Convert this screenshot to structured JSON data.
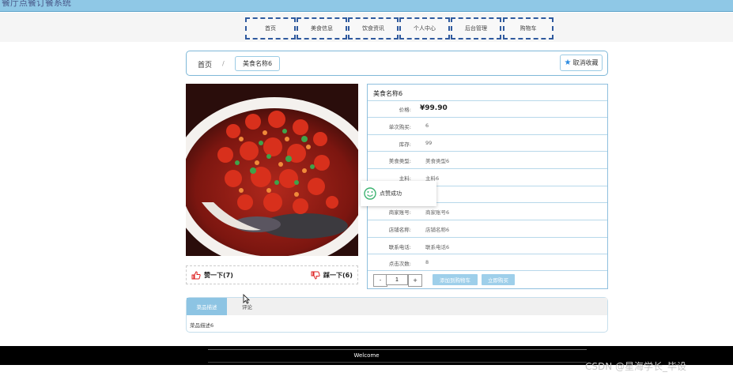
{
  "site": {
    "title": "餐厅点餐订餐系统"
  },
  "nav": {
    "items": [
      "首页",
      "美食信息",
      "饮食资讯",
      "个人中心",
      "后台管理",
      "购物车"
    ]
  },
  "breadcrumb": {
    "home": "首页",
    "separator": "/",
    "current": "美食名称6"
  },
  "favorite": {
    "label": "取消收藏",
    "icon": "star-icon"
  },
  "votes": {
    "up_label": "赞一下(7)",
    "down_label": "踩一下(6)"
  },
  "details": {
    "title": "美食名称6",
    "rows": [
      {
        "label": "价格:",
        "value": "¥99.90"
      },
      {
        "label": "单次购买:",
        "value": "6"
      },
      {
        "label": "库存:",
        "value": "99"
      },
      {
        "label": "美食类型:",
        "value": "美食类型6"
      },
      {
        "label": "主料:",
        "value": "主料6"
      },
      {
        "label": "",
        "value": "6"
      },
      {
        "label": "商家账号:",
        "value": "商家账号6"
      },
      {
        "label": "店铺名称:",
        "value": "店铺名称6"
      },
      {
        "label": "联系电话:",
        "value": "联系电话6"
      },
      {
        "label": "点击次数:",
        "value": "8"
      }
    ]
  },
  "cart": {
    "minus": "-",
    "quantity": "1",
    "plus": "+",
    "add_label": "添加到购物车",
    "buy_label": "立即购买"
  },
  "toast": {
    "text": "点赞成功"
  },
  "tabs": {
    "detail_label": "菜品描述",
    "comment_label": "评论",
    "content": "菜品描述6"
  },
  "footer": {
    "text": "Welcome"
  },
  "watermark": "CSDN @星海学长_毕设",
  "colors": {
    "topbar": "#8fc8e6",
    "accent": "#9ecfea",
    "nav_border": "#2f5a9e",
    "footer": "#000000"
  }
}
